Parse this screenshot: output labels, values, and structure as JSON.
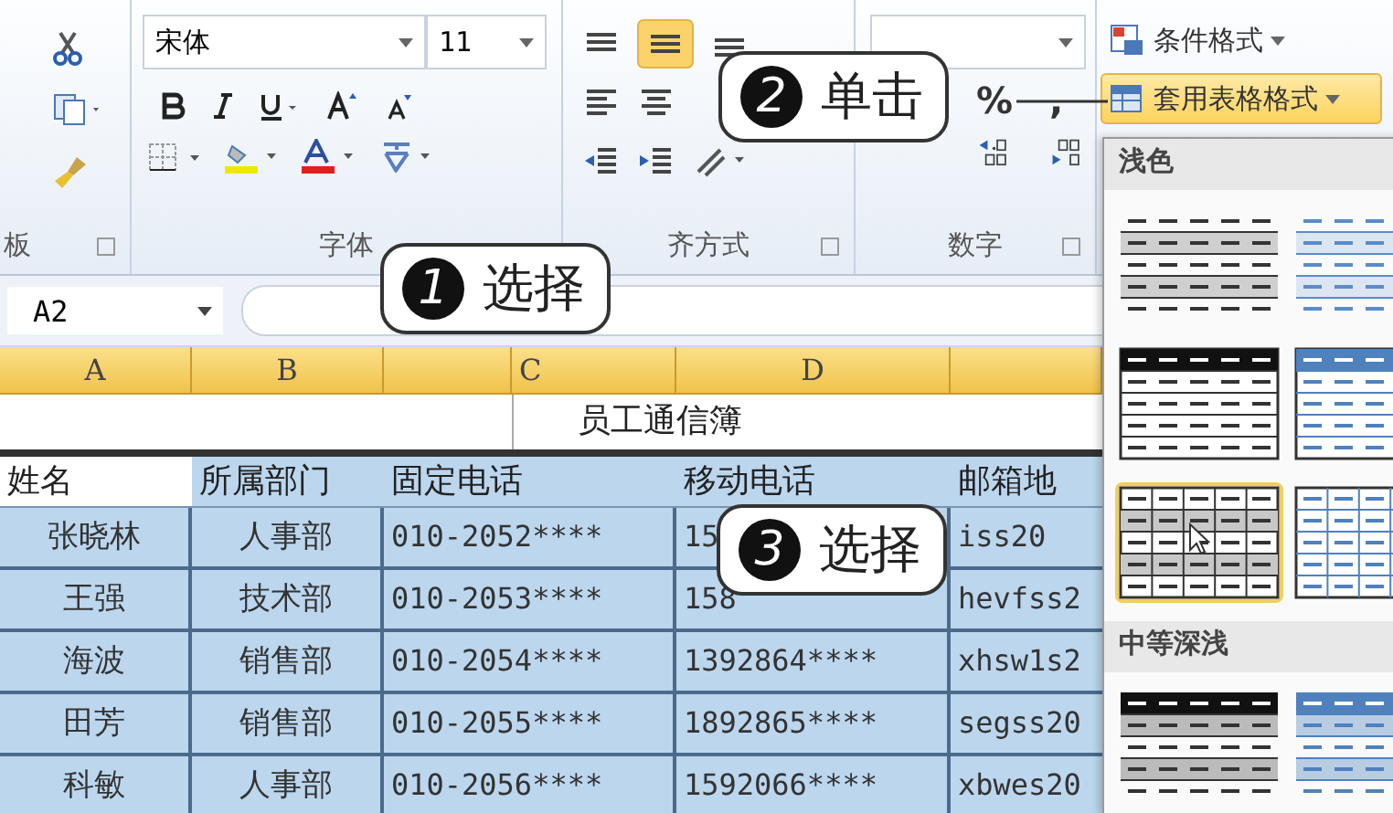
{
  "ribbon": {
    "clipboard_label": "板",
    "font": {
      "name": "宋体",
      "size": "11",
      "label": "字体"
    },
    "alignment": {
      "label": "齐方式"
    },
    "number": {
      "percent": "%",
      "comma": ",",
      "label": "数字"
    },
    "styles": {
      "conditional": "条件格式",
      "format_table": {
        "label": "套用表格格式",
        "pressed": true
      }
    }
  },
  "formula_bar": {
    "name_box": "A2"
  },
  "sheet": {
    "columns": [
      "A",
      "B",
      "",
      "C",
      "D",
      ""
    ],
    "title": "员工通信簿",
    "headers": [
      "姓名",
      "所属部门",
      "固定电话",
      "移动电话",
      "邮箱地"
    ],
    "rows": [
      {
        "name": "张晓林",
        "dept": "人事部",
        "phone": "010-2052****",
        "mobile": "15",
        "email": "iss20"
      },
      {
        "name": "王强",
        "dept": "技术部",
        "phone": "010-2053****",
        "mobile": "158",
        "email": "hevfss2"
      },
      {
        "name": "海波",
        "dept": "销售部",
        "phone": "010-2054****",
        "mobile": "1392864****",
        "email": "xhsw1s2"
      },
      {
        "name": "田芳",
        "dept": "销售部",
        "phone": "010-2055****",
        "mobile": "1892865****",
        "email": "segss20"
      },
      {
        "name": "科敏",
        "dept": "人事部",
        "phone": "010-2056****",
        "mobile": "1592066****",
        "email": "xbwes20"
      }
    ]
  },
  "gallery": {
    "sections": [
      {
        "title": "浅色",
        "styles": [
          {
            "kind": "plain",
            "selected": false
          },
          {
            "kind": "plain-blue",
            "selected": false
          },
          {
            "kind": "dark-header",
            "selected": false
          },
          {
            "kind": "blue-header",
            "selected": false
          },
          {
            "kind": "grid",
            "selected": true
          },
          {
            "kind": "grid-blue",
            "selected": false
          }
        ]
      },
      {
        "title": "中等深浅",
        "styles": [
          {
            "kind": "dark-band",
            "selected": false
          },
          {
            "kind": "blue-band",
            "selected": false
          }
        ]
      }
    ]
  },
  "callouts": [
    {
      "number": "1",
      "text": "选择"
    },
    {
      "number": "2",
      "text": "单击"
    },
    {
      "number": "3",
      "text": "选择"
    }
  ]
}
